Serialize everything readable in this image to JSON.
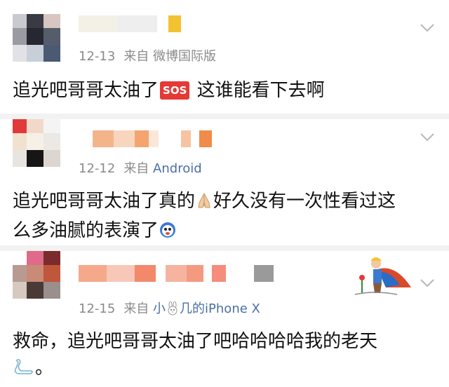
{
  "comments": [
    {
      "time": "12-13",
      "source": "来自 微博国际版",
      "text_before": "追光吧哥哥太油了",
      "badge": "SOS",
      "text_after": " 这谁能看下去啊"
    },
    {
      "time": "12-12",
      "source_prefix": "来自",
      "source_name": "Android",
      "line1_before": "追光吧哥哥太油了真的",
      "line1_after": "好久没有一次性看过这",
      "line2": "么多油腻的表演了",
      "emojis": [
        "pray-emoji",
        "dizzy-face-emoji"
      ]
    },
    {
      "time": "12-15",
      "source_prefix": "来自",
      "source_a": "小",
      "source_b": "几的iPhone X",
      "line1": "救命，追光吧哥哥太油了吧哈哈哈哈我的老天",
      "line2_after": "。",
      "emojis": [
        "rabbit-emoji",
        "swan-emoji"
      ]
    }
  ],
  "icons": [
    "chevron-down-icon"
  ],
  "colors": {
    "meta_gray": "#8a8a8a",
    "source_blue": "#4a6fa5",
    "badge_red": "#e53935"
  }
}
